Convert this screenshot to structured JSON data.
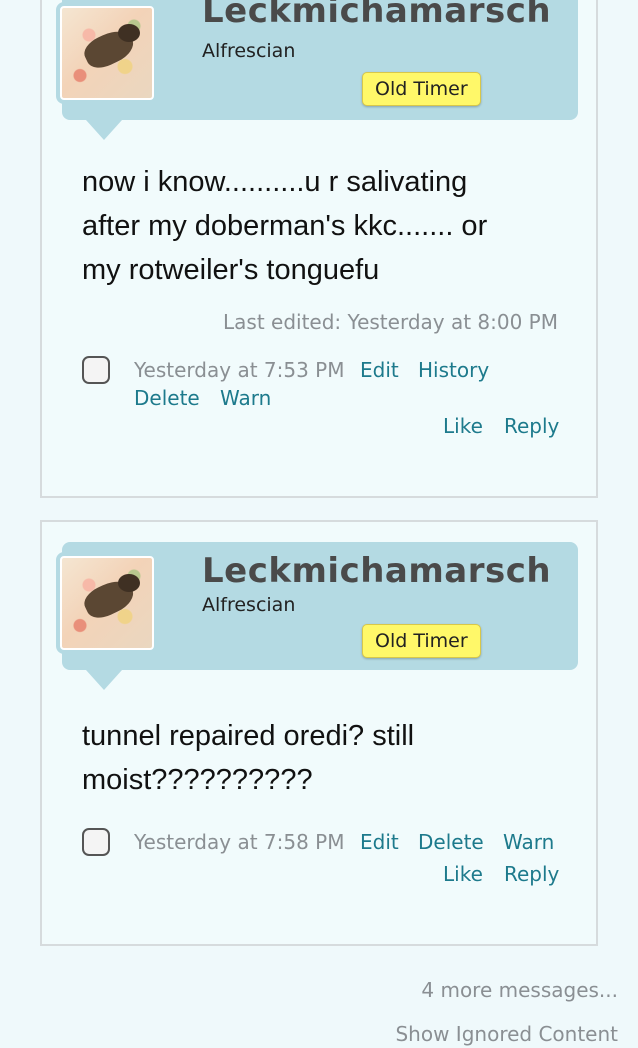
{
  "posts": [
    {
      "username": "Leckmichamarsch",
      "usertitle": "Alfrescian",
      "badge": "Old Timer",
      "message": [
        "now i know..........u r salivating",
        "after my doberman's kkc....... or",
        "my rotweiler's tonguefu"
      ],
      "last_edited": "Last edited: Yesterday at 8:00 PM",
      "timestamp": "Yesterday at 7:53 PM",
      "actions": {
        "edit": "Edit",
        "history": "History",
        "delete": "Delete",
        "warn": "Warn",
        "like": "Like",
        "reply": "Reply"
      }
    },
    {
      "username": "Leckmichamarsch",
      "usertitle": "Alfrescian",
      "badge": "Old Timer",
      "message": [
        "tunnel repaired oredi? still",
        "moist??????????"
      ],
      "timestamp": "Yesterday at 7:58 PM",
      "actions": {
        "edit": "Edit",
        "delete": "Delete",
        "warn": "Warn",
        "like": "Like",
        "reply": "Reply"
      }
    }
  ],
  "footer": {
    "more_messages": "4 more messages...",
    "show_ignored": "Show Ignored Content"
  },
  "colors": {
    "userbar": "#b4dae3",
    "link": "#1d7a8c",
    "badge": "#fff869",
    "background": "#eff9fb"
  }
}
